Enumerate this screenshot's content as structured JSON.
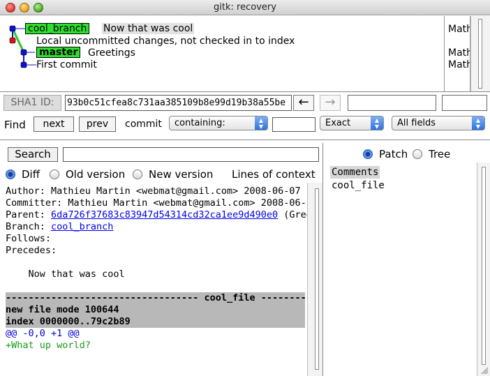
{
  "window": {
    "title": "gitk: recovery"
  },
  "graph": {
    "commits": [
      {
        "branch": "cool_branch",
        "message": "Now that was cool",
        "author": "Math"
      },
      {
        "message": "Local uncommitted changes, not checked in to index"
      },
      {
        "branch": "master",
        "message": "Greetings",
        "author": "Math"
      },
      {
        "message": "First commit",
        "author": "Math"
      }
    ]
  },
  "sha": {
    "label": "SHA1 ID:",
    "value": "93b0c51cfea8c731aa385109b8e99d19b38a55be"
  },
  "find": {
    "label": "Find",
    "next_label": "next",
    "prev_label": "prev",
    "commit_label": "commit",
    "mode": "containing:",
    "match": "Exact",
    "fields": "All fields"
  },
  "search": {
    "button_label": "Search"
  },
  "view_options": {
    "diff": "Diff",
    "old_version": "Old version",
    "new_version": "New version",
    "context_label": "Lines of context"
  },
  "tree_options": {
    "patch": "Patch",
    "tree": "Tree"
  },
  "diff": {
    "author": "Author: Mathieu Martin <webmat@gmail.com>  2008-06-07",
    "committer": "Committer: Mathieu Martin <webmat@gmail.com>  2008-06-",
    "parent_prefix": "Parent: ",
    "parent_hash": "6da726f37683c83947d54314cd32ca1ee9d490e0",
    "parent_suffix": " (Gree",
    "branch_prefix": "Branch: ",
    "branch_name": "cool_branch",
    "follows": "Follows:",
    "precedes": "Precedes:",
    "message": "    Now that was cool",
    "file_header": "---------------------------------- cool_file ----------",
    "mode_line": "new file mode 100644",
    "index_line": "index 0000000..79c2b89",
    "hunk": "@@ -0,0 +1 @@",
    "added_line": "+What up world?"
  },
  "files": [
    "Comments",
    "cool_file"
  ],
  "colors": {
    "branch_label": "#2ee02e",
    "node_blue": "#1010d0",
    "node_red": "#e01010",
    "hunk": "#0000dd",
    "added": "#1a9a1a"
  }
}
